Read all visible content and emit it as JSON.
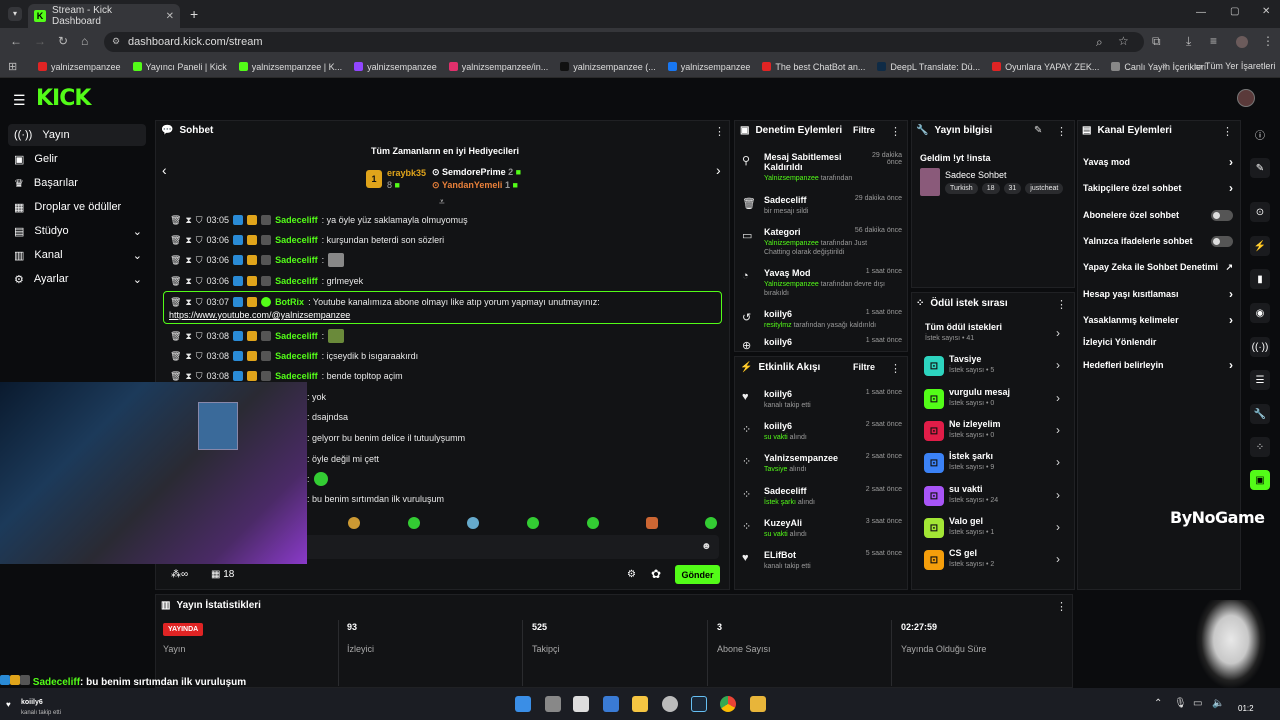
{
  "browser": {
    "tab_title": "Stream - Kick Dashboard",
    "url": "dashboard.kick.com/stream",
    "bookmarks": [
      {
        "label": "yalnizsempanzee",
        "color": "#e02424"
      },
      {
        "label": "Yayıncı Paneli | Kick",
        "color": "#53fc18"
      },
      {
        "label": "yalnizsempanzee | K...",
        "color": "#53fc18"
      },
      {
        "label": "yalnizsempanzee",
        "color": "#9146ff"
      },
      {
        "label": "yalnizsempanzee/in...",
        "color": "#e1306c"
      },
      {
        "label": "yalnizsempanzee (...",
        "color": "#111111"
      },
      {
        "label": "yalnizsempanzee",
        "color": "#1877f2"
      },
      {
        "label": "The best ChatBot an...",
        "color": "#e02424"
      },
      {
        "label": "DeepL Translate: Dü...",
        "color": "#0f2b46"
      },
      {
        "label": "Oyunlara YAPAY ZEK...",
        "color": "#e02424"
      },
      {
        "label": "Canlı Yayın İçerikleri",
        "color": "#888888"
      }
    ],
    "all_bookmarks": "Tüm Yer İşaretleri"
  },
  "kick": {
    "logo": "KICK"
  },
  "sidebar": {
    "items": [
      {
        "label": "Yayın",
        "icon": "broadcast-icon"
      },
      {
        "label": "Gelir",
        "icon": "income-icon"
      },
      {
        "label": "Başarılar",
        "icon": "trophy-icon"
      },
      {
        "label": "Droplar ve ödüller",
        "icon": "gift-icon"
      },
      {
        "label": "Stüdyo",
        "icon": "studio-icon"
      },
      {
        "label": "Kanal",
        "icon": "channel-icon"
      },
      {
        "label": "Ayarlar",
        "icon": "gear-icon"
      }
    ]
  },
  "chat": {
    "title": "Sohbet",
    "top_gifters_title": "Tüm Zamanların en iyi Hediyecileri",
    "gifters": [
      {
        "rank": "1",
        "name": "eraybk35",
        "count": "8"
      },
      {
        "rank": "",
        "name": "SemdorePrime",
        "count": "2"
      },
      {
        "rank": "",
        "name": "YandanYemeli",
        "count": "1"
      }
    ],
    "messages": [
      {
        "time": "03:05",
        "user": "Sadeceliff",
        "text": ": ya öyle yüz saklamayla olmuyomuş"
      },
      {
        "time": "03:06",
        "user": "Sadeceliff",
        "text": ": kurşundan beterdi son sözleri"
      },
      {
        "time": "03:06",
        "user": "Sadeceliff",
        "text": ":"
      },
      {
        "time": "03:06",
        "user": "Sadeceliff",
        "text": ": grlmeyek"
      },
      {
        "time": "03:08",
        "user": "Sadeceliff",
        "text": ":"
      },
      {
        "time": "03:08",
        "user": "Sadeceliff",
        "text": ": içseydik b isıgaraakırdı"
      },
      {
        "time": "03:08",
        "user": "Sadeceliff",
        "text": ": bende topltop açim"
      }
    ],
    "bot_message": {
      "time": "03:07",
      "user": "BotRix",
      "text": ": Youtube kanalımıza abone olmayı like atıp yorum yapmayı unutmayınız:",
      "link": "https://www.youtube.com/@yalnizsempanzee"
    },
    "hidden_messages": [
      ": yok",
      ": dsajndsa",
      ": gelyorr bu benim delice il tutuulyşumm",
      ": öyle değil mi çett",
      ":",
      ": bu benim sırtımdan ilk vuruluşum"
    ],
    "viewers_icon": "∞",
    "count": "18",
    "send_label": "Gönder"
  },
  "mod": {
    "title": "Denetim Eylemleri",
    "filter": "Filtre",
    "items": [
      {
        "title": "Mesaj Sabitlemesi Kaldırıldı",
        "by": "Yalnizsempanzee",
        "sub": "tarafından",
        "time": "29 dakika önce"
      },
      {
        "title": "Sadeceliff",
        "by": "",
        "sub": "bir mesajı sildi",
        "time": "29 dakika önce"
      },
      {
        "title": "Kategori",
        "by": "Yalnizsempanzee",
        "sub": "tarafından Just Chatting olarak değiştirildi",
        "time": "56 dakika önce"
      },
      {
        "title": "Yavaş Mod",
        "by": "Yalnizsempanzee",
        "sub": "tarafından devre dışı bırakıldı",
        "time": "1 saat önce"
      },
      {
        "title": "koiily6",
        "by": "resitylmz",
        "sub": "tarafından yasağı kaldırıldı",
        "time": "1 saat önce"
      },
      {
        "title": "koiily6",
        "by": "",
        "sub": "",
        "time": "1 saat önce"
      }
    ]
  },
  "activity": {
    "title": "Etkinlik Akışı",
    "filter": "Filtre",
    "items": [
      {
        "name": "koiily6",
        "sub": "kanalı takip etti",
        "time": "1 saat önce",
        "green": ""
      },
      {
        "name": "koiily6",
        "sub": " alındı",
        "time": "2 saat önce",
        "green": "su vakti"
      },
      {
        "name": "Yalnizsempanzee",
        "sub": " alındı",
        "time": "2 saat önce",
        "green": "Tavsiye"
      },
      {
        "name": "Sadeceliff",
        "sub": " alındı",
        "time": "2 saat önce",
        "green": "İstek şarkı"
      },
      {
        "name": "KuzeyAli",
        "sub": " alındı",
        "time": "3 saat önce",
        "green": "su vakti"
      },
      {
        "name": "ELifBot",
        "sub": "kanalı takip etti",
        "time": "5 saat önce",
        "green": ""
      }
    ]
  },
  "stream_info": {
    "title": "Yayın bilgisi",
    "stream_title": "Geldim !yt !insta",
    "category": "Sadece Sohbet",
    "tags": [
      "Turkish",
      "18",
      "31",
      "justcheat"
    ]
  },
  "rewards": {
    "title": "Ödül istek sırası",
    "all": {
      "title": "Tüm ödül istekleri",
      "sub": "İstek sayısı • 41"
    },
    "items": [
      {
        "title": "Tavsiye",
        "sub": "İstek sayısı • 5",
        "color": "#2dd4bf"
      },
      {
        "title": "vurgulu mesaj",
        "sub": "İstek sayısı • 0",
        "color": "#53fc18"
      },
      {
        "title": "Ne izleyelim",
        "sub": "İstek sayısı • 0",
        "color": "#e11d48"
      },
      {
        "title": "İstek şarkı",
        "sub": "İstek sayısı • 9",
        "color": "#3b82f6"
      },
      {
        "title": "su vakti",
        "sub": "İstek sayısı • 24",
        "color": "#a855f7"
      },
      {
        "title": "Valo gel",
        "sub": "İstek sayısı • 1",
        "color": "#a3e635"
      },
      {
        "title": "CS gel",
        "sub": "İstek sayısı • 2",
        "color": "#f59e0b"
      }
    ]
  },
  "channel": {
    "title": "Kanal Eylemleri",
    "items": [
      {
        "label": "Yavaş mod",
        "control": "chevron"
      },
      {
        "label": "Takipçilere özel sohbet",
        "control": "chevron"
      },
      {
        "label": "Abonelere özel sohbet",
        "control": "toggle"
      },
      {
        "label": "Yalnızca ifadelerle sohbet",
        "control": "toggle"
      },
      {
        "label": "Yapay Zeka ile Sohbet Denetimi",
        "control": "external"
      },
      {
        "label": "Hesap yaşı kısıtlaması",
        "control": "chevron"
      },
      {
        "label": "Yasaklanmış kelimeler",
        "control": "chevron"
      },
      {
        "label": "İzleyici Yönlendir",
        "control": "none"
      },
      {
        "label": "Hedefleri belirleyin",
        "control": "chevron"
      }
    ]
  },
  "stats": {
    "title": "Yayın İstatistikleri",
    "items": [
      {
        "value": "YAYINDA",
        "label": "Yayın"
      },
      {
        "value": "93",
        "label": "İzleyici"
      },
      {
        "value": "525",
        "label": "Takipçi"
      },
      {
        "value": "3",
        "label": "Abone Sayısı"
      },
      {
        "value": "02:27:59",
        "label": "Yayında Olduğu Süre"
      }
    ]
  },
  "overlay": {
    "chat_user": "Sadeceliff",
    "chat_text": ": bu benim sırtımdan ilk vuruluşum",
    "follow_name": "koiily6",
    "follow_sub": "kanalı takip etti",
    "watermark": "ByNoGame",
    "clock": "01:2"
  }
}
